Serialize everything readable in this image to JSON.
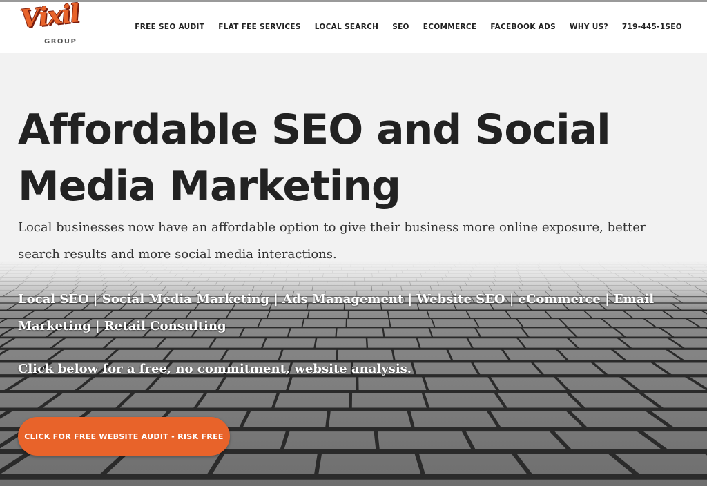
{
  "brand": {
    "logo_script": "Vixil",
    "logo_sub": "GROUP",
    "accent": "#e8632a"
  },
  "nav": {
    "items": [
      {
        "label": "FREE SEO AUDIT"
      },
      {
        "label": "FLAT FEE SERVICES"
      },
      {
        "label": "LOCAL SEARCH"
      },
      {
        "label": "SEO"
      },
      {
        "label": "ECOMMERCE"
      },
      {
        "label": "FACEBOOK ADS"
      },
      {
        "label": "WHY US?"
      },
      {
        "label": "719-445-1SEO"
      }
    ]
  },
  "hero": {
    "headline": "Affordable SEO and Social Media Marketing",
    "subtext": "Local businesses now have an affordable option to give their business more online exposure, better search results and more social media interactions.",
    "services": "Local SEO | Social Media Marketing | Ads Management | Website SEO | eCommerce | Email Marketing | Retail Consulting",
    "prompt": "Click below for a free, no commitment, website analysis.",
    "cta_label": "CLICK FOR FREE WEBSITE AUDIT - RISK FREE",
    "background": "grey-brick-pavement-photo"
  }
}
